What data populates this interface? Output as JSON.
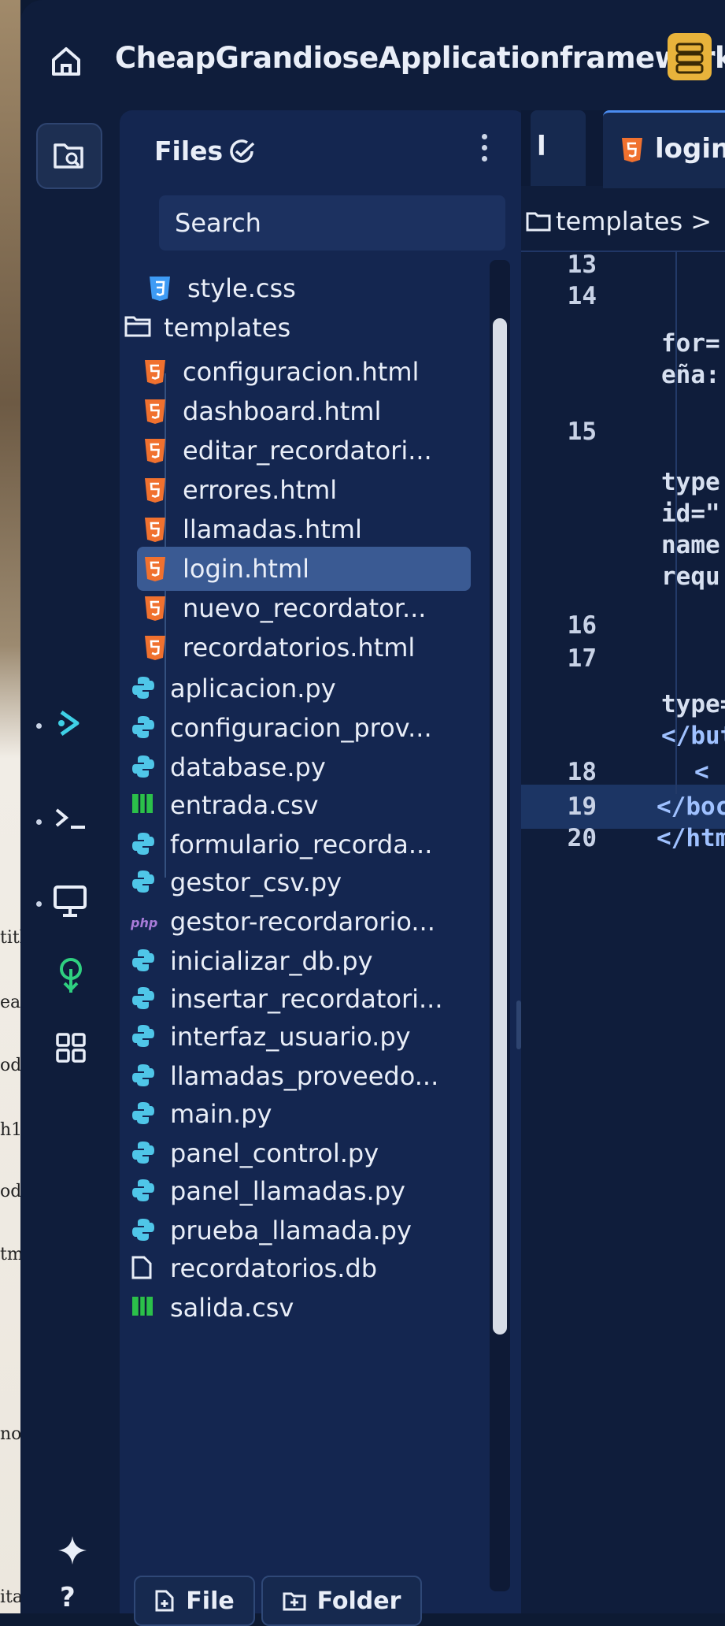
{
  "app": {
    "title": "CheapGrandioseApplicationframework"
  },
  "files_panel": {
    "title": "Files",
    "search_placeholder": "Search",
    "items": [
      {
        "name": "style.css",
        "type": "css"
      },
      {
        "name": "templates",
        "type": "folder"
      },
      {
        "name": "configuracion.html",
        "type": "html"
      },
      {
        "name": "dashboard.html",
        "type": "html"
      },
      {
        "name": "editar_recordatori...",
        "type": "html"
      },
      {
        "name": "errores.html",
        "type": "html"
      },
      {
        "name": "llamadas.html",
        "type": "html"
      },
      {
        "name": "login.html",
        "type": "html",
        "selected": true
      },
      {
        "name": "nuevo_recordator...",
        "type": "html"
      },
      {
        "name": "recordatorios.html",
        "type": "html"
      },
      {
        "name": "aplicacion.py",
        "type": "python"
      },
      {
        "name": "configuracion_prov...",
        "type": "python"
      },
      {
        "name": "database.py",
        "type": "python"
      },
      {
        "name": "entrada.csv",
        "type": "csv"
      },
      {
        "name": "formulario_recorda...",
        "type": "python"
      },
      {
        "name": "gestor_csv.py",
        "type": "python"
      },
      {
        "name": "gestor-recordarorio...",
        "type": "php"
      },
      {
        "name": "inicializar_db.py",
        "type": "python"
      },
      {
        "name": "insertar_recordatori...",
        "type": "python"
      },
      {
        "name": "interfaz_usuario.py",
        "type": "python"
      },
      {
        "name": "llamadas_proveedo...",
        "type": "python"
      },
      {
        "name": "main.py",
        "type": "python"
      },
      {
        "name": "panel_control.py",
        "type": "python"
      },
      {
        "name": "panel_llamadas.py",
        "type": "python"
      },
      {
        "name": "prueba_llamada.py",
        "type": "python"
      },
      {
        "name": "recordatorios.db",
        "type": "file"
      },
      {
        "name": "salida.csv",
        "type": "csv"
      }
    ],
    "footer": {
      "file_label": "File",
      "folder_label": "Folder"
    }
  },
  "editor": {
    "tab_partial": "l",
    "active_tab": "login.h",
    "breadcrumb": "templates >",
    "lines": [
      {
        "num": "13",
        "code": ""
      },
      {
        "num": "14",
        "code": ""
      },
      {
        "num": "",
        "code": "for="
      },
      {
        "num": "",
        "code": "eña:"
      },
      {
        "num": "15",
        "code": ""
      },
      {
        "num": "",
        "code": "type"
      },
      {
        "num": "",
        "code": "id=\""
      },
      {
        "num": "",
        "code": "name"
      },
      {
        "num": "",
        "code": "requ"
      },
      {
        "num": "16",
        "code": ""
      },
      {
        "num": "17",
        "code": ""
      },
      {
        "num": "",
        "code": "type="
      },
      {
        "num": "",
        "code": "</but"
      },
      {
        "num": "18",
        "code": "<"
      },
      {
        "num": "19",
        "code": "</boc"
      },
      {
        "num": "20",
        "code": "</htm"
      }
    ]
  },
  "background_strip": [
    "titl",
    "ea",
    "ody",
    "h1",
    "od",
    "tm",
    "no",
    "itar"
  ],
  "colors": {
    "html_icon": "#f0712f",
    "css_icon": "#3e9bf5",
    "python_icon": "#4fc6e8",
    "csv_icon": "#2bc04a",
    "php_icon": "#a77bd8",
    "db_icon_bg": "#e8b33b"
  }
}
